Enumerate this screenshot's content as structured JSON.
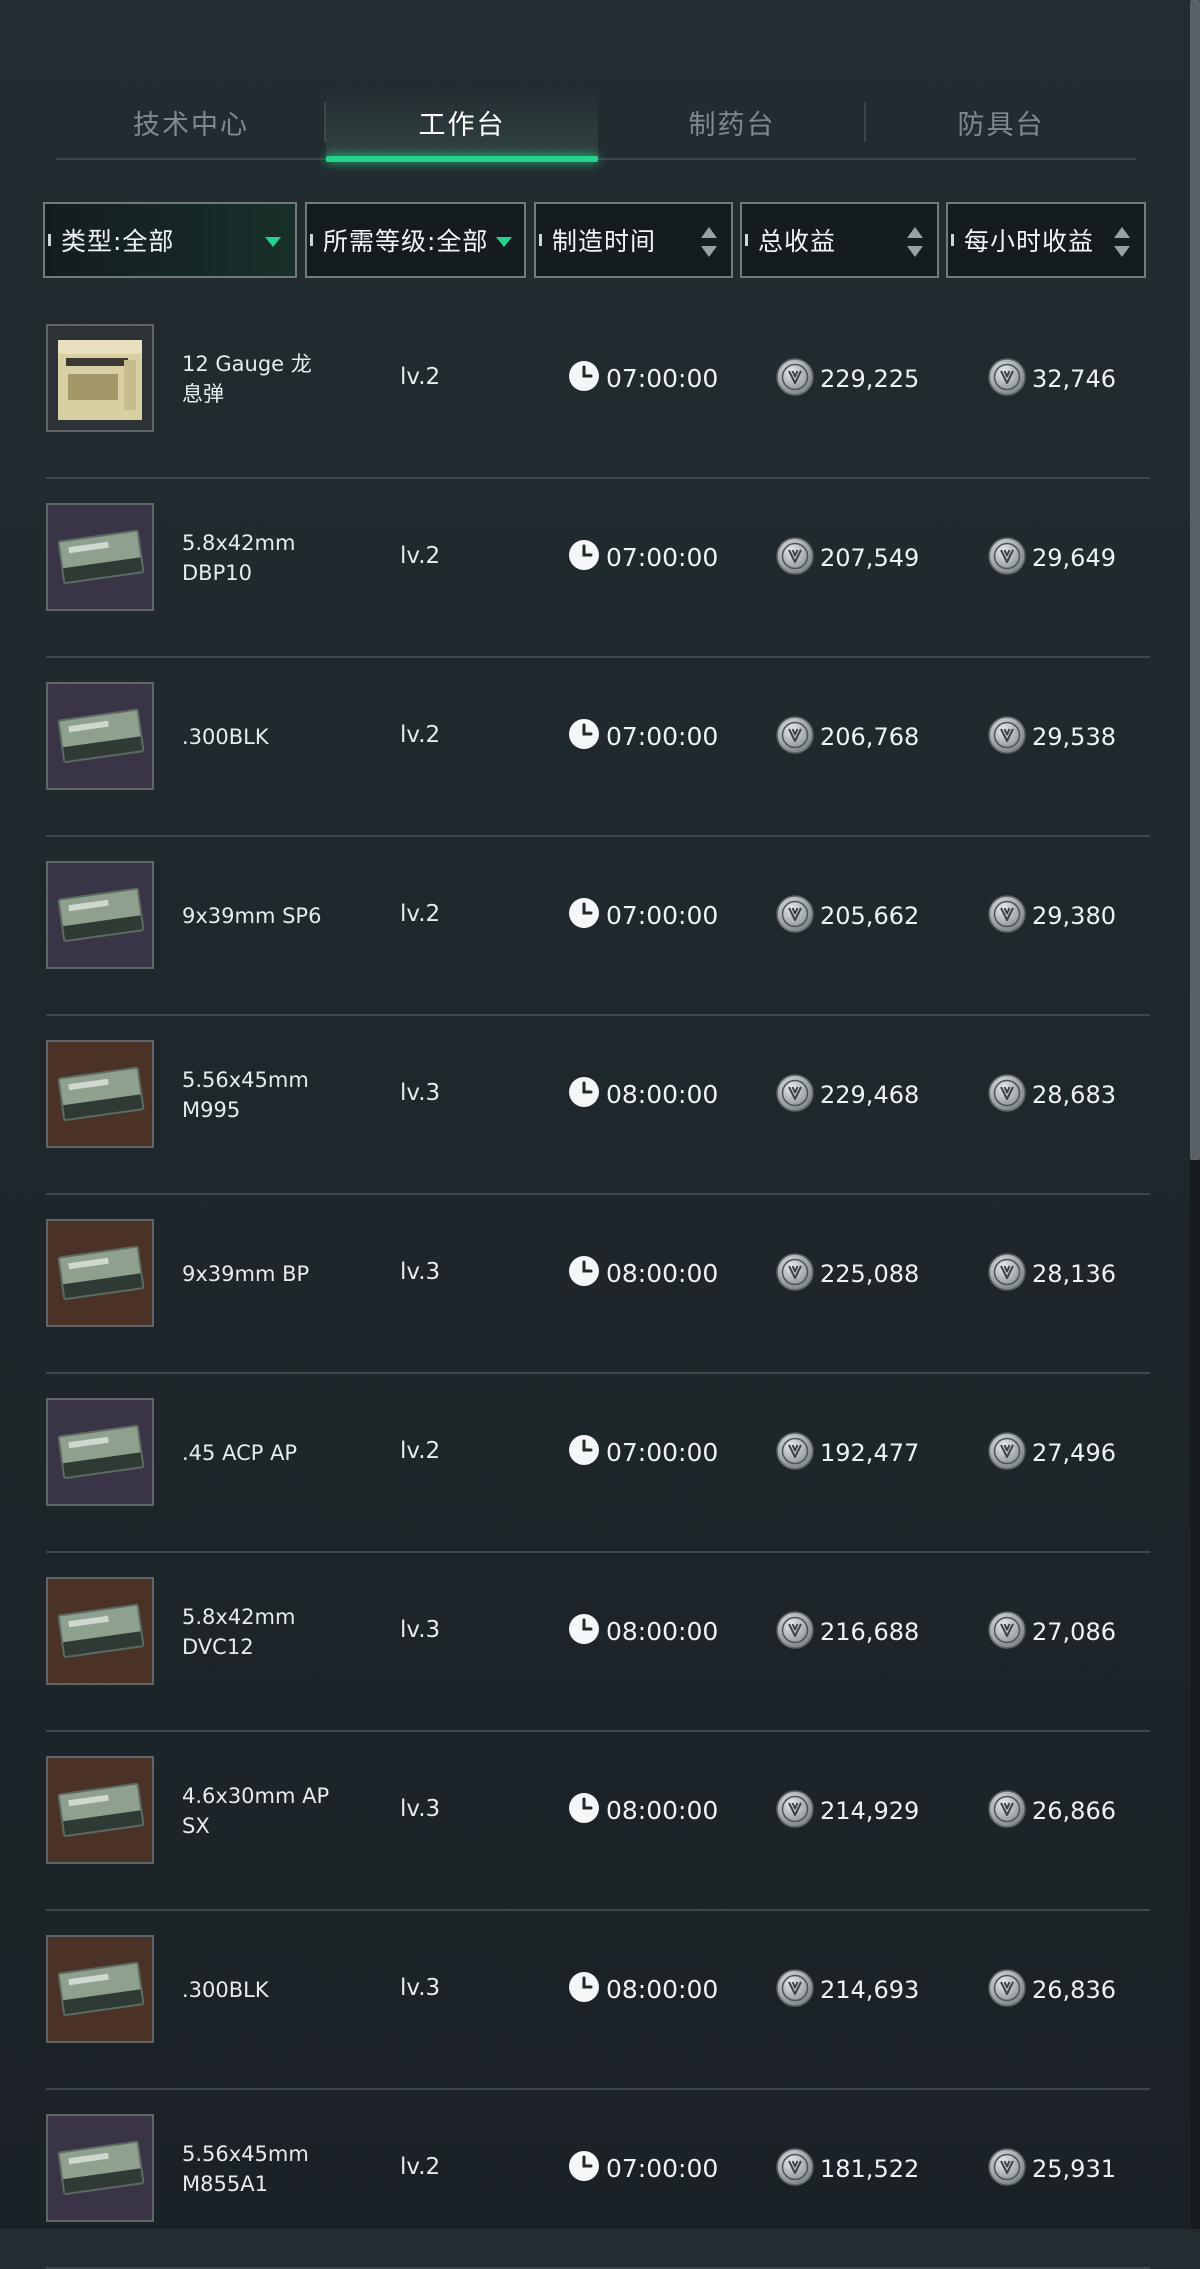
{
  "tabs": [
    {
      "label": "技术中心",
      "active": false
    },
    {
      "label": "工作台",
      "active": true
    },
    {
      "label": "制药台",
      "active": false
    },
    {
      "label": "防具台",
      "active": false
    }
  ],
  "filters": {
    "type": "类型:全部",
    "level": "所需等级:全部",
    "time": "制造时间",
    "total": "总收益",
    "hourly": "每小时收益"
  },
  "colors": {
    "accent": "#27d38a",
    "background": "#1f282d"
  },
  "icons": {
    "clock": "clock-icon",
    "coin": "coin-icon",
    "dropdown": "triangle-down-icon",
    "sort": "sort-updown-icon"
  },
  "items": [
    {
      "name": "12 Gauge 龙息弹",
      "level": "lv.2",
      "time": "07:00:00",
      "total": "229,225",
      "hourly": "32,746",
      "thumb_color": "#d9d0a6"
    },
    {
      "name": "5.8x42mm DBP10",
      "level": "lv.2",
      "time": "07:00:00",
      "total": "207,549",
      "hourly": "29,649",
      "thumb_color": "#3a3447"
    },
    {
      "name": ".300BLK",
      "level": "lv.2",
      "time": "07:00:00",
      "total": "206,768",
      "hourly": "29,538",
      "thumb_color": "#3a3447"
    },
    {
      "name": "9x39mm SP6",
      "level": "lv.2",
      "time": "07:00:00",
      "total": "205,662",
      "hourly": "29,380",
      "thumb_color": "#3a3447"
    },
    {
      "name": "5.56x45mm M995",
      "level": "lv.3",
      "time": "08:00:00",
      "total": "229,468",
      "hourly": "28,683",
      "thumb_color": "#4a3326"
    },
    {
      "name": "9x39mm BP",
      "level": "lv.3",
      "time": "08:00:00",
      "total": "225,088",
      "hourly": "28,136",
      "thumb_color": "#4a3326"
    },
    {
      "name": ".45 ACP AP",
      "level": "lv.2",
      "time": "07:00:00",
      "total": "192,477",
      "hourly": "27,496",
      "thumb_color": "#3a3447"
    },
    {
      "name": "5.8x42mm DVC12",
      "level": "lv.3",
      "time": "08:00:00",
      "total": "216,688",
      "hourly": "27,086",
      "thumb_color": "#4a3326"
    },
    {
      "name": "4.6x30mm AP SX",
      "level": "lv.3",
      "time": "08:00:00",
      "total": "214,929",
      "hourly": "26,866",
      "thumb_color": "#4a3326"
    },
    {
      "name": ".300BLK",
      "level": "lv.3",
      "time": "08:00:00",
      "total": "214,693",
      "hourly": "26,836",
      "thumb_color": "#4a3326"
    },
    {
      "name": "5.56x45mm M855A1",
      "level": "lv.2",
      "time": "07:00:00",
      "total": "181,522",
      "hourly": "25,931",
      "thumb_color": "#3a3447"
    }
  ]
}
